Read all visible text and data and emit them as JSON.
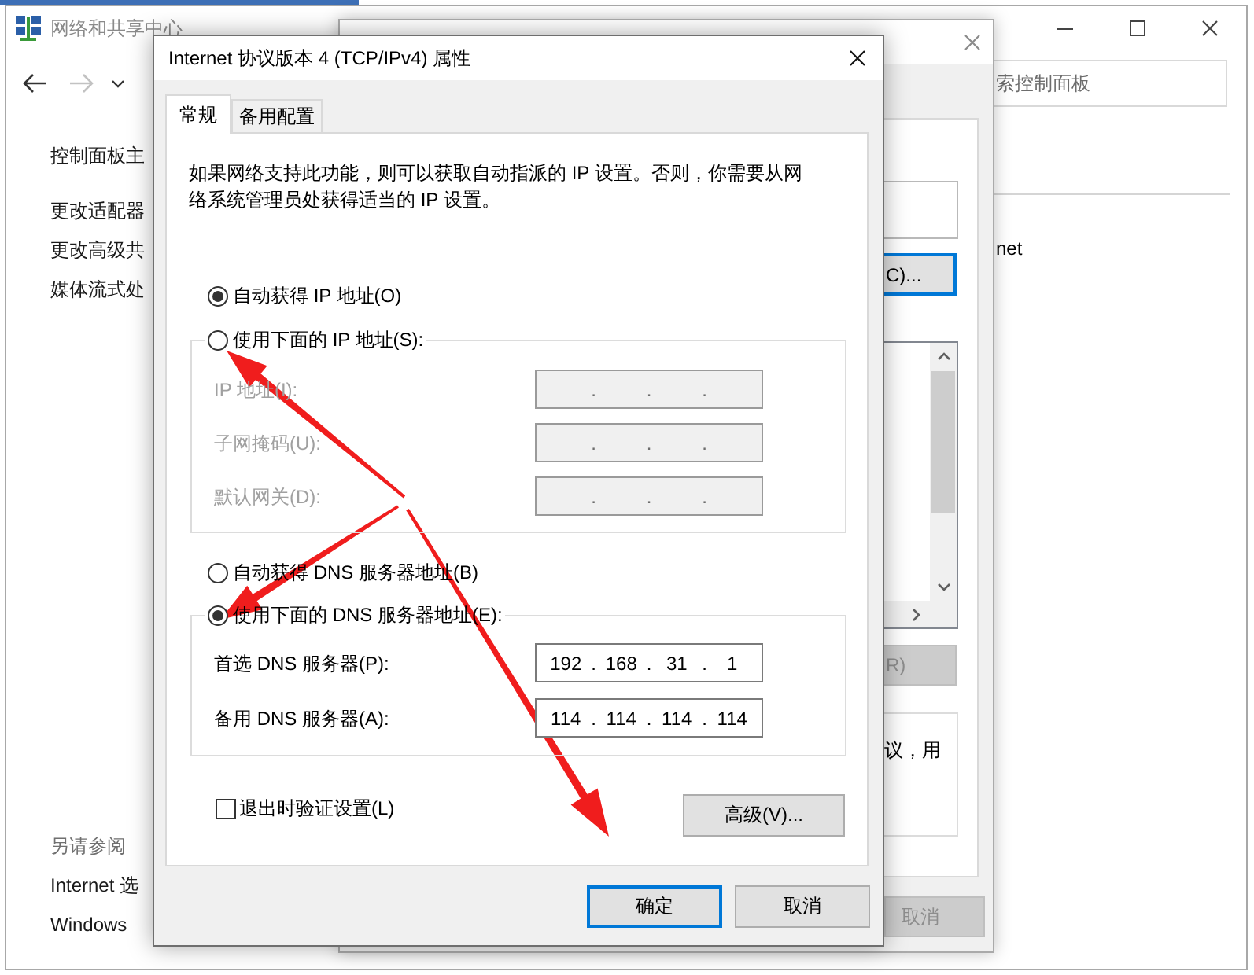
{
  "background_window": {
    "title": "网络和共享中心",
    "nav_buttons": [
      {
        "kind": "back",
        "disabled": false
      },
      {
        "kind": "forward",
        "disabled": true
      },
      {
        "kind": "recent",
        "disabled": false
      }
    ],
    "search": {
      "placeholder": "索控制面板"
    },
    "home_link": "控制面板主",
    "tasks": [
      "更改适配器",
      "更改高级共",
      "媒体流式处"
    ],
    "see_also": {
      "heading": "另请参阅",
      "links": [
        "Internet 选",
        "Windows"
      ]
    },
    "network_name": "net"
  },
  "ethernet_dialog": {
    "configure_button": {
      "label": "C)...",
      "default": true
    },
    "properties_button": {
      "label": "R)",
      "disabled": true
    },
    "description": "议，用",
    "cancel_button": {
      "label": "取消",
      "disabled": true
    }
  },
  "ipv4_dialog": {
    "title": "Internet 协议版本 4 (TCP/IPv4) 属性",
    "tabs": [
      {
        "label": "常规",
        "selected": true
      },
      {
        "label": "备用配置",
        "selected": false
      }
    ],
    "intro": "如果网络支持此功能，则可以获取自动指派的 IP 设置。否则，你需要从网络系统管理员处获得适当的 IP 设置。",
    "ip_options": [
      {
        "label": "自动获得 IP 地址(O)",
        "selected": true
      },
      {
        "label": "使用下面的 IP 地址(S):",
        "selected": false
      }
    ],
    "ip_fields": [
      {
        "label": "IP 地址(I):",
        "disabled": true,
        "dots": [
          ".",
          ".",
          "."
        ]
      },
      {
        "label": "子网掩码(U):",
        "disabled": true,
        "dots": [
          ".",
          ".",
          "."
        ]
      },
      {
        "label": "默认网关(D):",
        "disabled": true,
        "dots": [
          ".",
          ".",
          "."
        ]
      }
    ],
    "dns_options": [
      {
        "label": "自动获得 DNS 服务器地址(B)",
        "selected": false
      },
      {
        "label": "使用下面的 DNS 服务器地址(E):",
        "selected": true
      }
    ],
    "dns_fields": [
      {
        "label": "首选 DNS 服务器(P):",
        "disabled": false,
        "octets": [
          "192",
          "168",
          "31",
          "1"
        ],
        "dots": [
          ".",
          ".",
          "."
        ]
      },
      {
        "label": "备用 DNS 服务器(A):",
        "disabled": false,
        "octets": [
          "114",
          "114",
          "114",
          "114"
        ],
        "dots": [
          ".",
          ".",
          "."
        ]
      }
    ],
    "validate_checkbox": {
      "label": "退出时验证设置(L)",
      "checked": false
    },
    "advanced_button": {
      "label": "高级(V)..."
    },
    "buttons": [
      {
        "label": "确定",
        "default": true
      },
      {
        "label": "取消",
        "default": false
      }
    ]
  }
}
